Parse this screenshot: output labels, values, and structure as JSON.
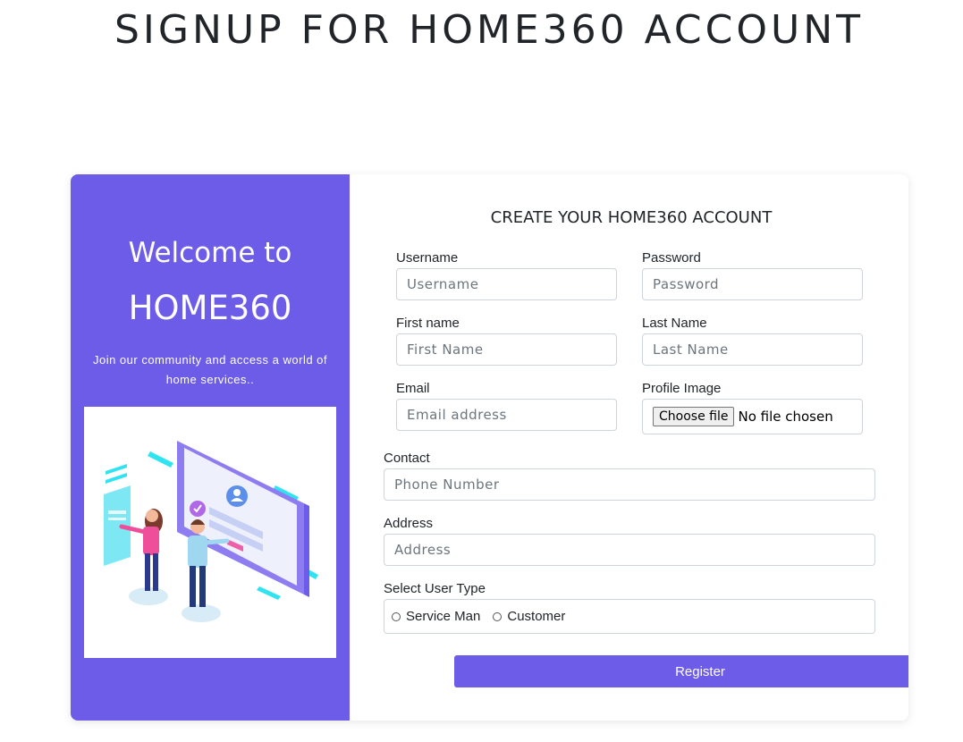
{
  "page": {
    "title": "SIGNUP FOR HOME360 ACCOUNT"
  },
  "welcome_panel": {
    "welcome_text": "Welcome to",
    "brand": "HOME360",
    "tagline": "Join our community and access a world of home services..",
    "illustration": "onboarding-illustration"
  },
  "form": {
    "title": "CREATE YOUR HOME360 ACCOUNT",
    "username": {
      "label": "Username",
      "placeholder": "Username",
      "value": ""
    },
    "password": {
      "label": "Password",
      "placeholder": "Password",
      "value": ""
    },
    "first_name": {
      "label": "First name",
      "placeholder": "First Name",
      "value": ""
    },
    "last_name": {
      "label": "Last Name",
      "placeholder": "Last Name",
      "value": ""
    },
    "email": {
      "label": "Email",
      "placeholder": "Email address",
      "value": ""
    },
    "profile_image": {
      "label": "Profile Image",
      "button_label": "Choose file",
      "status": "No file chosen"
    },
    "contact": {
      "label": "Contact",
      "placeholder": "Phone Number",
      "value": ""
    },
    "address": {
      "label": "Address",
      "placeholder": "Address",
      "value": ""
    },
    "user_type": {
      "label": "Select User Type",
      "options": [
        {
          "label": "Service Man",
          "selected": false
        },
        {
          "label": "Customer",
          "selected": false
        }
      ]
    },
    "register_label": "Register"
  },
  "colors": {
    "accent": "#6c5ce7",
    "border": "#ced4da",
    "text": "#212529"
  }
}
